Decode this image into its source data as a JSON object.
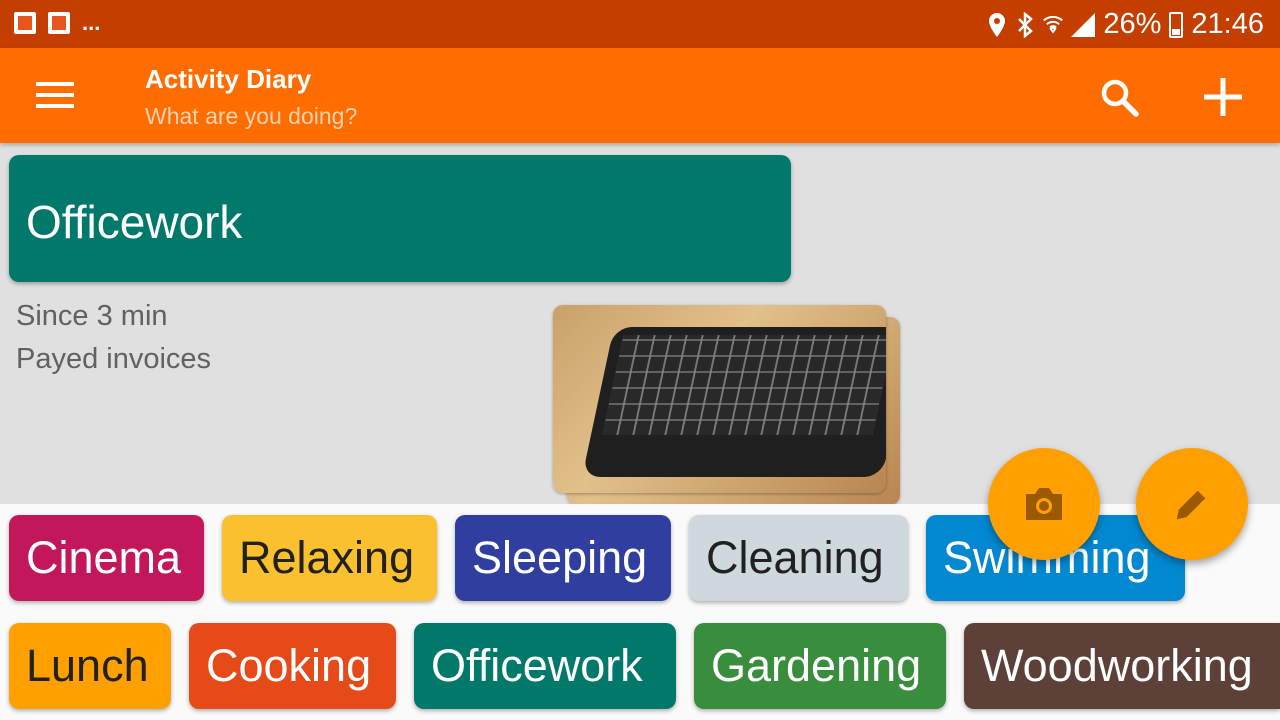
{
  "status_bar": {
    "notifications": [
      "app-notification-icon",
      "image-notification-icon",
      "app-notification-icon"
    ],
    "more": "...",
    "icons": [
      "location-icon",
      "bluetooth-icon",
      "wifi-icon",
      "signal-icon"
    ],
    "battery": "26%",
    "time": "21:46"
  },
  "toolbar": {
    "title": "Activity Diary",
    "subtitle": "What are you doing?",
    "menu_icon": "menu-icon",
    "search_icon": "search-icon",
    "add_icon": "add-icon"
  },
  "current": {
    "name": "Officework",
    "color": "#00796b",
    "since": "Since 3 min",
    "note": "Payed invoices",
    "photo": "keyboard-photo"
  },
  "activities": [
    {
      "name": "Cinema",
      "color": "#c2185b",
      "text_color": "#ffffff"
    },
    {
      "name": "Relaxing",
      "color": "#fbc02d",
      "text_color": "#212121"
    },
    {
      "name": "Sleeping",
      "color": "#303f9f",
      "text_color": "#ffffff"
    },
    {
      "name": "Cleaning",
      "color": "#cfd8dc",
      "text_color": "#212121"
    },
    {
      "name": "Swimming",
      "color": "#0288d1",
      "text_color": "#ffffff"
    },
    {
      "name": "Lunch",
      "color": "#ffa000",
      "text_color": "#212121"
    },
    {
      "name": "Cooking",
      "color": "#e64a19",
      "text_color": "#ffffff"
    },
    {
      "name": "Officework",
      "color": "#00796b",
      "text_color": "#ffffff"
    },
    {
      "name": "Gardening",
      "color": "#388e3c",
      "text_color": "#ffffff"
    },
    {
      "name": "Woodworking",
      "color": "#5d4037",
      "text_color": "#ffffff"
    }
  ],
  "fabs": {
    "camera_icon": "camera-icon",
    "edit_icon": "edit-icon",
    "color": "#ffa000"
  },
  "colors": {
    "status_bar": "#c43e00",
    "toolbar": "#ff6d00"
  }
}
